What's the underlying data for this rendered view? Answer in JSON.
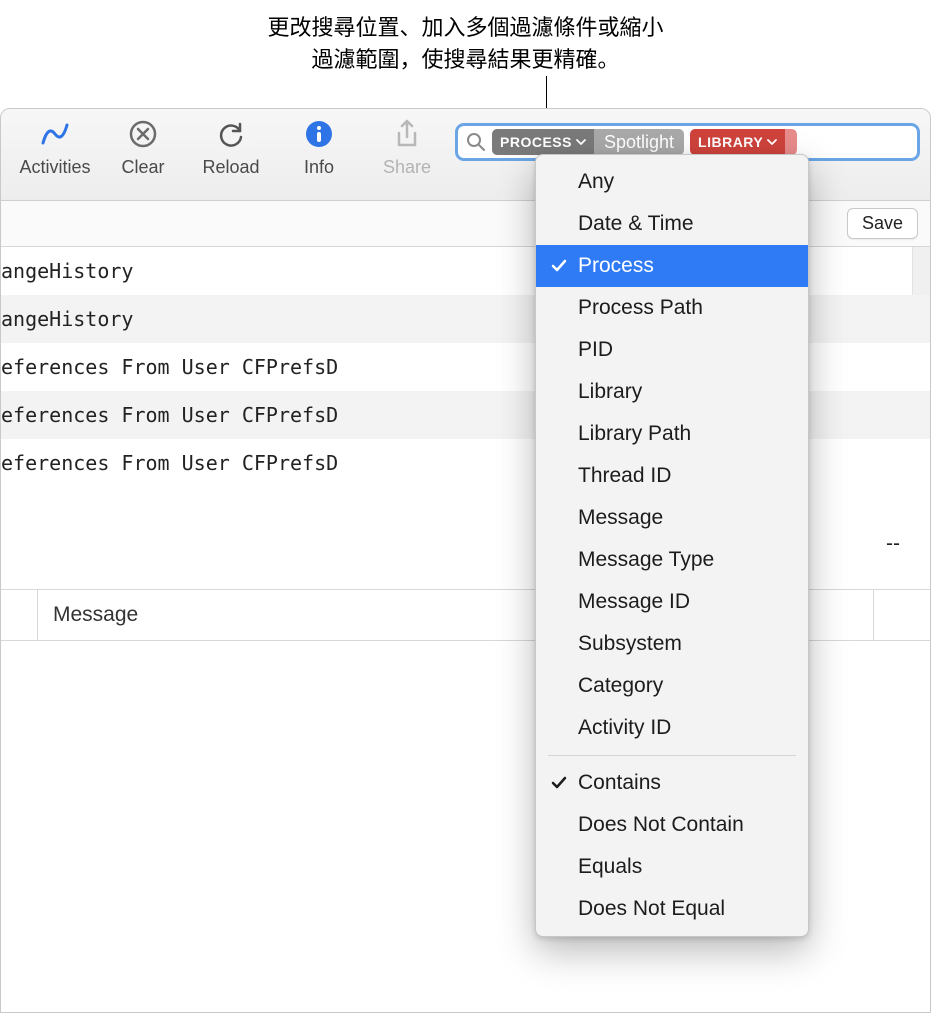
{
  "callout": {
    "line1": "更改搜尋位置、加入多個過濾條件或縮小",
    "line2": "過濾範圍，使搜尋結果更精確。"
  },
  "toolbar": {
    "activities": "Activities",
    "clear": "Clear",
    "reload": "Reload",
    "info": "Info",
    "share": "Share"
  },
  "search": {
    "filter1_tag": "PROCESS",
    "filter1_value": "Spotlight",
    "filter2_tag": "LIBRARY"
  },
  "sub": {
    "save": "Save"
  },
  "logs": [
    "angeHistory",
    "angeHistory",
    "eferences From User CFPrefsD",
    "eferences From User CFPrefsD",
    "eferences From User CFPrefsD"
  ],
  "double_dash": "--",
  "detail": {
    "message": "Message"
  },
  "dropdown": {
    "group1": [
      "Any",
      "Date & Time",
      "Process",
      "Process Path",
      "PID",
      "Library",
      "Library Path",
      "Thread ID",
      "Message",
      "Message Type",
      "Message ID",
      "Subsystem",
      "Category",
      "Activity ID"
    ],
    "selected1": "Process",
    "group2": [
      "Contains",
      "Does Not Contain",
      "Equals",
      "Does Not Equal"
    ],
    "selected2": "Contains"
  }
}
